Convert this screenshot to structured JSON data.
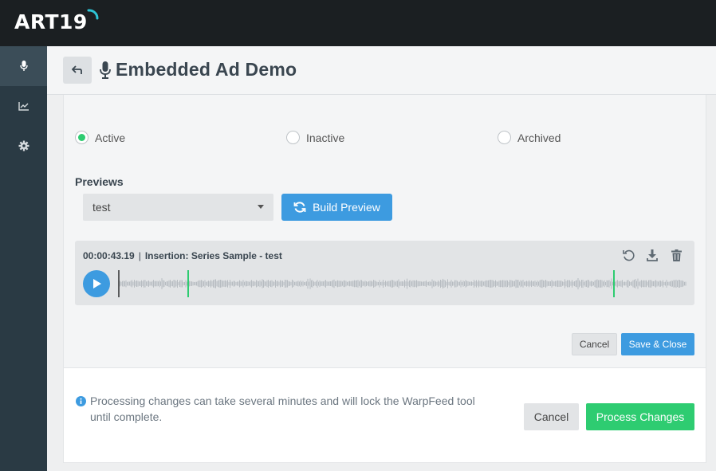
{
  "app": {
    "logo_text": "ART19",
    "accent_color": "#3d9be0",
    "success_color": "#2ecc71"
  },
  "sidebar": {
    "items": [
      {
        "name": "podcasts",
        "icon": "microphone-icon",
        "active": true
      },
      {
        "name": "analytics",
        "icon": "line-chart-icon",
        "active": false
      },
      {
        "name": "settings",
        "icon": "gear-icon",
        "active": false
      }
    ]
  },
  "header": {
    "title": "Embedded Ad Demo",
    "back_icon": "back-arrow-icon",
    "title_icon": "microphone-icon"
  },
  "status": {
    "options": [
      {
        "label": "Active",
        "selected": true
      },
      {
        "label": "Inactive",
        "selected": false
      },
      {
        "label": "Archived",
        "selected": false
      }
    ]
  },
  "previews": {
    "label": "Previews",
    "selected": "test",
    "build_label": "Build Preview"
  },
  "player": {
    "timestamp": "00:00:43.19",
    "separator": "|",
    "insertion_text": "Insertion: Series Sample - test",
    "tools": [
      "undo-icon",
      "download-icon",
      "trash-icon"
    ]
  },
  "edit_actions": {
    "cancel_label": "Cancel",
    "save_label": "Save & Close"
  },
  "footer": {
    "message": "Processing changes can take several minutes and will lock the WarpFeed tool until complete.",
    "cancel_label": "Cancel",
    "process_label": "Process Changes"
  }
}
